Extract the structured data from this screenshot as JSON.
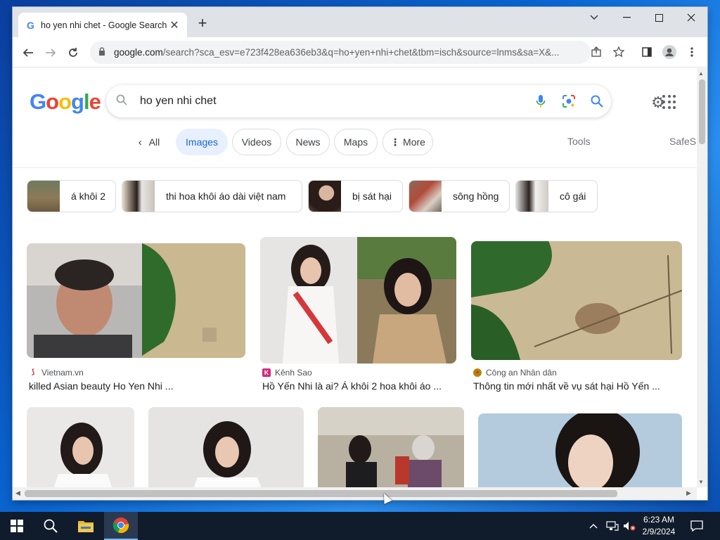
{
  "browser": {
    "tab_title": "ho yen nhi chet - Google Search",
    "url_host": "google.com",
    "url_rest": "/search?sca_esv=e723f428ea636eb3&q=ho+yen+nhi+chet&tbm=isch&source=lnms&sa=X&..."
  },
  "search": {
    "logo_letters": [
      "G",
      "o",
      "o",
      "g",
      "l",
      "e"
    ],
    "query": "ho yen nhi chet"
  },
  "filters": {
    "all": "All",
    "images": "Images",
    "videos": "Videos",
    "news": "News",
    "maps": "Maps",
    "more": "More",
    "tools": "Tools",
    "safesearch": "SafeS"
  },
  "suggestions": [
    {
      "label": "á khôi 2"
    },
    {
      "label": "thi hoa khôi áo dài việt nam"
    },
    {
      "label": "bị sát hại"
    },
    {
      "label": "sông hồng"
    },
    {
      "label": "cô gái"
    }
  ],
  "results": [
    {
      "source": "Vietnam.vn",
      "caption": "killed Asian beauty Ho Yen Nhi ..."
    },
    {
      "source": "Kênh Sao",
      "caption": "Hồ Yến Nhi là ai? Á khôi 2 hoa khôi áo ..."
    },
    {
      "source": "Công an Nhân dân",
      "caption": "Thông tin mới nhất về vụ sát hại Hồ Yến ..."
    }
  ],
  "taskbar": {
    "time": "6:23 AM",
    "date": "2/9/2024"
  },
  "colors": {
    "accent": "#1967d2",
    "chip_active_bg": "#e8f0fe",
    "taskbar": "#101b2b"
  }
}
